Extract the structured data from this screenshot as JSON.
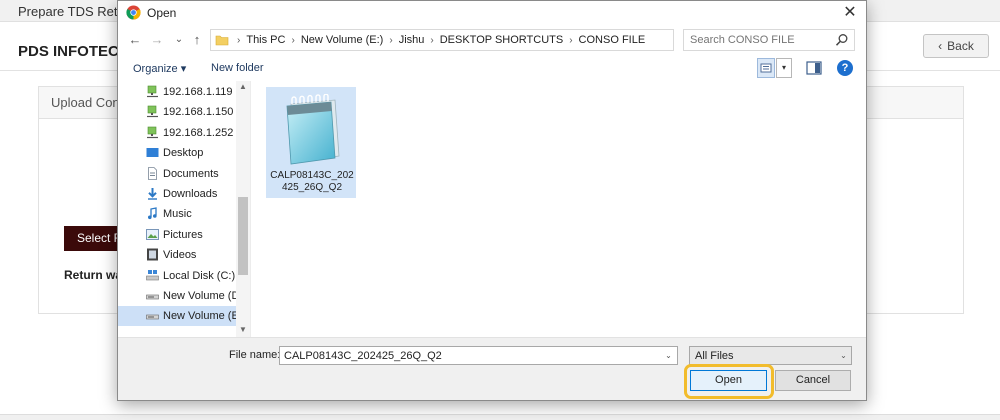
{
  "page": {
    "tab_title": "Prepare TDS Return",
    "brand": "PDS INFOTECH",
    "back_label": "Back",
    "upload_card_title": "Upload Conso",
    "select_button": "Select File",
    "return_text": "Return was"
  },
  "dialog": {
    "title": "Open",
    "close_glyph": "✕",
    "nav": {
      "back": "←",
      "forward": "→",
      "recent": "⌄",
      "up": "↑"
    },
    "address": {
      "crumbs": [
        "This PC",
        "New Volume (E:)",
        "Jishu",
        "DESKTOP SHORTCUTS",
        "CONSO FILE"
      ],
      "separator": "›",
      "dropdown_glyph": "⌄",
      "refresh_glyph": "↻"
    },
    "search_placeholder": "Search CONSO FILE",
    "toolbar": {
      "organize": "Organize",
      "organize_arrow": "▾",
      "new_folder": "New folder",
      "view_dropdown": "▾",
      "help": "?"
    },
    "tree": {
      "items": [
        {
          "label": "192.168.1.119",
          "icon": "network-drive-icon",
          "selected": false
        },
        {
          "label": "192.168.1.150",
          "icon": "network-drive-icon",
          "selected": false
        },
        {
          "label": "192.168.1.252",
          "icon": "network-drive-icon",
          "selected": false
        },
        {
          "label": "Desktop",
          "icon": "desktop-icon",
          "selected": false
        },
        {
          "label": "Documents",
          "icon": "documents-icon",
          "selected": false
        },
        {
          "label": "Downloads",
          "icon": "downloads-icon",
          "selected": false
        },
        {
          "label": "Music",
          "icon": "music-icon",
          "selected": false
        },
        {
          "label": "Pictures",
          "icon": "pictures-icon",
          "selected": false
        },
        {
          "label": "Videos",
          "icon": "videos-icon",
          "selected": false
        },
        {
          "label": "Local Disk (C:)",
          "icon": "local-disk-icon",
          "selected": false
        },
        {
          "label": "New Volume (D:)",
          "icon": "drive-icon",
          "selected": false
        },
        {
          "label": "New Volume (E:)",
          "icon": "drive-icon",
          "selected": true
        }
      ],
      "scroll_up": "▲",
      "scroll_down": "▼"
    },
    "files": [
      {
        "name": "CALP08143C_202425_26Q_Q2",
        "icon": "notepad-file-icon",
        "selected": true
      }
    ],
    "file_name_label": "File name:",
    "file_name_value": "CALP08143C_202425_26Q_Q2",
    "file_type_value": "All Files",
    "combo_glyph": "⌄",
    "open_button": "Open",
    "cancel_button": "Cancel"
  },
  "colors": {
    "highlight_ring": "#f2bc2c",
    "selection_fill": "#cde0f7",
    "select_button_bg": "#3b0a0a",
    "help_blue": "#1d6fce"
  }
}
